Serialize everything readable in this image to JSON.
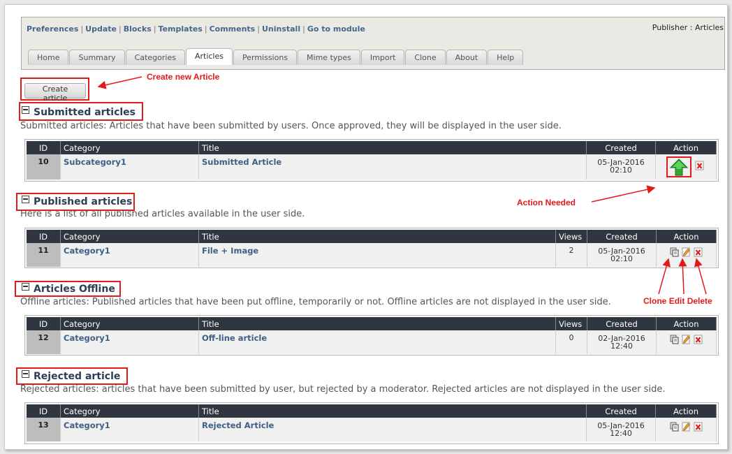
{
  "nav": {
    "links": [
      "Preferences",
      "Update",
      "Blocks",
      "Templates",
      "Comments",
      "Uninstall",
      "Go to module"
    ],
    "breadcrumb": "Publisher : Articles",
    "tabs": [
      "Home",
      "Summary",
      "Categories",
      "Articles",
      "Permissions",
      "Mime types",
      "Import",
      "Clone",
      "About",
      "Help"
    ],
    "active_tab": "Articles"
  },
  "create_button": "Create article",
  "annotations": {
    "create_new": "Create new Article",
    "action_needed": "Action Needed",
    "clone": "Clone",
    "edit": "Edit",
    "delete": "Delete"
  },
  "columns": {
    "id": "ID",
    "category": "Category",
    "title": "Title",
    "views": "Views",
    "created": "Created",
    "action": "Action"
  },
  "sections": {
    "submitted": {
      "title": "Submitted articles",
      "desc": "Submitted articles: Articles that have been submitted by users. Once approved, they will be displayed in the user side.",
      "row": {
        "id": "10",
        "category": "Subcategory1",
        "title": "Submitted Article",
        "date": "05-Jan-2016",
        "time": "02:10"
      }
    },
    "published": {
      "title": "Published articles",
      "desc": "Here is a list of all published articles available in the user side.",
      "row": {
        "id": "11",
        "category": "Category1",
        "title": "File + Image",
        "views": "2",
        "date": "05-Jan-2016",
        "time": "02:10"
      }
    },
    "offline": {
      "title": "Articles Offline",
      "desc": "Offline articles: Published articles that have been put offline, temporarily or not. Offline articles are not displayed in the user side.",
      "row": {
        "id": "12",
        "category": "Category1",
        "title": "Off-line article",
        "views": "0",
        "date": "02-Jan-2016",
        "time": "12:40"
      }
    },
    "rejected": {
      "title": "Rejected article",
      "desc": "Rejected articles: articles that have been submitted by user, but rejected by a moderator. Rejected articles are not displayed in the user side.",
      "row": {
        "id": "13",
        "category": "Category1",
        "title": "Rejected Article",
        "date": "05-Jan-2016",
        "time": "12:40"
      }
    }
  },
  "icons": {
    "approve": "approve-arrow-icon",
    "clone": "clone-icon",
    "edit": "edit-pencil-icon",
    "delete": "delete-icon"
  },
  "colors": {
    "annotation": "#e21a1a",
    "header_bg": "#2f3640",
    "link": "#3f6085",
    "approve": "#2ea82e"
  }
}
